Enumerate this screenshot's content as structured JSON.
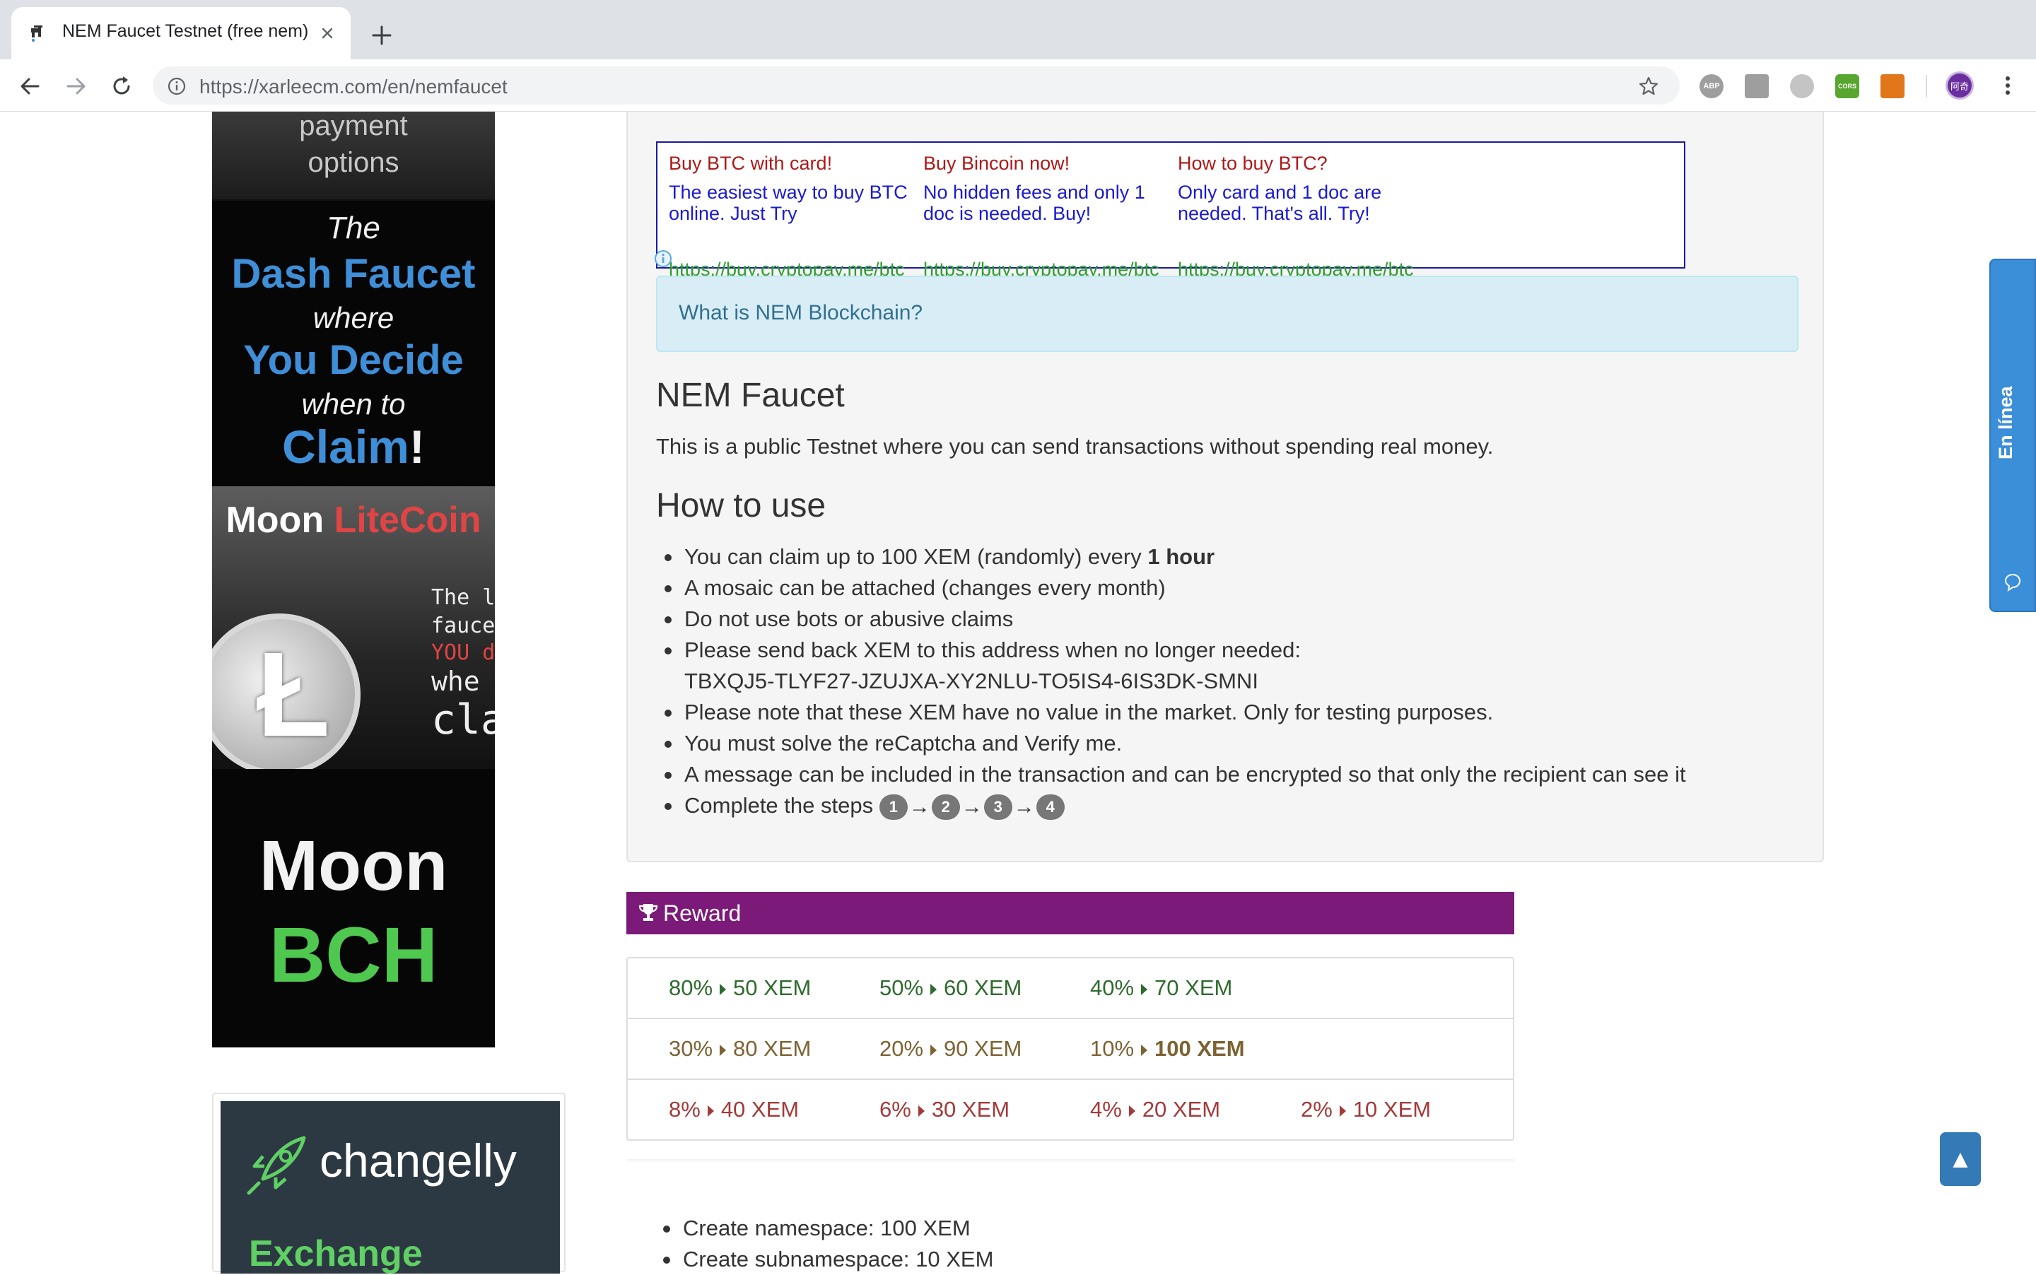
{
  "browser": {
    "tab_title": "NEM Faucet Testnet (free nem)",
    "url_host": "https://xarleecm.com",
    "url_path": "/en/nemfaucet",
    "extensions": [
      {
        "name": "abp-icon",
        "label": "ABP",
        "color": "#9e9e9e"
      },
      {
        "name": "screenshot-extension-icon",
        "label": "",
        "color": "#9e9e9e"
      },
      {
        "name": "extension-circle-icon",
        "label": "",
        "color": "#c4c4c4"
      },
      {
        "name": "cors-icon",
        "label": "CORS",
        "color": "#58a52f"
      },
      {
        "name": "metamask-fox-icon",
        "label": "",
        "color": "#e2761b"
      }
    ],
    "profile_label": "阿奇"
  },
  "banners": {
    "payment_line1": "payment",
    "payment_line2": "options",
    "dash": {
      "l1": "The",
      "l2": "Dash Faucet",
      "l3": "where",
      "l4": "You Decide",
      "l5": "when to",
      "l6": "Claim",
      "l6_suffix": "!"
    },
    "moon_litecoin": {
      "moon": "Moon",
      "coin": "LiteCoin",
      "side1": "The lit",
      "side2": "faucet",
      "side3": "YOU d",
      "side4": "whe",
      "side5": "cla"
    },
    "moon_bch": {
      "moon": "Moon",
      "bch": "BCH"
    },
    "changelly": {
      "brand": "changelly",
      "tagline": "Exchange"
    }
  },
  "ads": [
    {
      "title": "Buy BTC with card!",
      "desc": "The easiest way to buy BTC online. Just Try",
      "url": "https://buy.cryptopay.me/btc"
    },
    {
      "title": "Buy Bincoin now!",
      "desc": "No hidden fees and only 1 doc is needed. Buy!",
      "url": "https://buy.cryptopay.me/btc"
    },
    {
      "title": "How to buy BTC?",
      "desc": "Only card and 1 doc are needed. That's all. Try!",
      "url": "https://buy.cryptopay.me/btc"
    }
  ],
  "info_link": "What is NEM Blockchain?",
  "faucet": {
    "heading": "NEM Faucet",
    "intro": "This is a public Testnet where you can send transactions without spending real money."
  },
  "howto": {
    "heading": "How to use",
    "item1_pre": "You can claim up to 100 XEM (randomly) every ",
    "item1_bold": "1 hour",
    "item2": "A mosaic can be attached (changes every month)",
    "item3": "Do not use bots or abusive claims",
    "item4_line1": "Please send back XEM to this address when no longer needed:",
    "item4_line2": "TBXQJ5-TLYF27-JZUJXA-XY2NLU-TO5IS4-6IS3DK-SMNI",
    "item5": "Please note that these XEM have no value in the market. Only for testing purposes.",
    "item6": "You must solve the reCaptcha and Verify me.",
    "item7": "A message can be included in the transaction and can be encrypted so that only the recipient can see it",
    "item8": "Complete the steps",
    "steps": [
      "1",
      "2",
      "3",
      "4"
    ],
    "arrow": "→"
  },
  "reward": {
    "title": "Reward",
    "rows": [
      {
        "color": "#2e6b2e",
        "cells": [
          {
            "pct": "80%",
            "amount": "50 XEM",
            "bold": false
          },
          {
            "pct": "50%",
            "amount": "60 XEM",
            "bold": false
          },
          {
            "pct": "40%",
            "amount": "70 XEM",
            "bold": false
          }
        ]
      },
      {
        "color": "#7d6232",
        "cells": [
          {
            "pct": "30%",
            "amount": "80 XEM",
            "bold": false
          },
          {
            "pct": "20%",
            "amount": "90 XEM",
            "bold": false
          },
          {
            "pct": "10%",
            "amount": "100 XEM",
            "bold": true
          }
        ]
      },
      {
        "color": "#a33a3a",
        "cells": [
          {
            "pct": "8%",
            "amount": "40 XEM",
            "bold": false
          },
          {
            "pct": "6%",
            "amount": "30 XEM",
            "bold": false
          },
          {
            "pct": "4%",
            "amount": "20 XEM",
            "bold": false
          },
          {
            "pct": "2%",
            "amount": "10 XEM",
            "bold": false
          }
        ]
      }
    ]
  },
  "extra": {
    "item1": "Create namespace: 100 XEM",
    "item2": "Create subnamespace: 10 XEM"
  },
  "chat": {
    "label": "En línea"
  },
  "scroll_top": "▲"
}
